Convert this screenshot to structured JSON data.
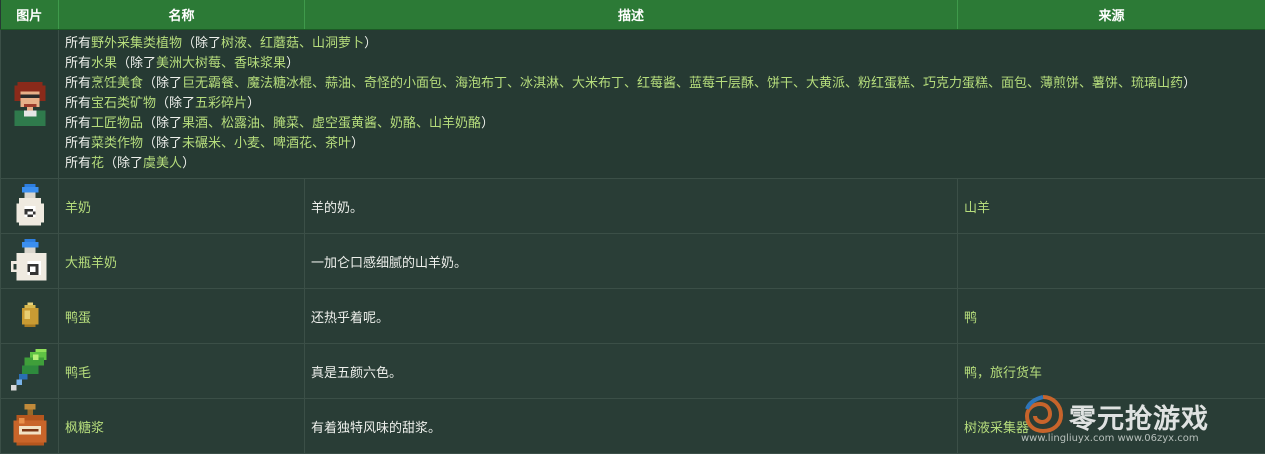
{
  "header": {
    "col_image": "图片",
    "col_name": "名称",
    "col_desc": "描述",
    "col_source": "来源"
  },
  "exclusions": {
    "prefix": "所有",
    "open": "（除了",
    "close": "）",
    "lines": [
      {
        "category": "野外采集类植物",
        "items": "树液、红蘑菇、山洞萝卜"
      },
      {
        "category": "水果",
        "items": "美洲大树莓、香味浆果"
      },
      {
        "category": "烹饪美食",
        "items": "巨无霸餐、魔法糖冰棍、蒜油、奇怪的小面包、海泡布丁、冰淇淋、大米布丁、红莓酱、蓝莓千层酥、饼干、大黄派、粉红蛋糕、巧克力蛋糕、面包、薄煎饼、薯饼、琉璃山药"
      },
      {
        "category": "宝石类矿物",
        "items": "五彩碎片"
      },
      {
        "category": "工匠物品",
        "items": "果酒、松露油、腌菜、虚空蛋黄酱、奶酪、山羊奶酪"
      },
      {
        "category": "菜类作物",
        "items": "未碾米、小麦、啤酒花、茶叶"
      },
      {
        "category": "花",
        "items": "虞美人"
      }
    ]
  },
  "rows": [
    {
      "name": "羊奶",
      "desc": "羊的奶。",
      "source": "山羊",
      "icon": "goat-milk-icon"
    },
    {
      "name": "大瓶羊奶",
      "desc": "一加仑口感细腻的山羊奶。",
      "source": "",
      "icon": "large-goat-milk-icon"
    },
    {
      "name": "鸭蛋",
      "desc": "还热乎着呢。",
      "source": "鸭",
      "icon": "duck-egg-icon"
    },
    {
      "name": "鸭毛",
      "desc": "真是五颜六色。",
      "source": "鸭，旅行货车",
      "icon": "duck-feather-icon"
    },
    {
      "name": "枫糖浆",
      "desc": "有着独特风味的甜浆。",
      "source": "树液采集器",
      "icon": "maple-syrup-icon"
    }
  ],
  "watermark": {
    "title": "零元抢游戏",
    "url": "www.lingliuyx.com    www.06zyx.com"
  },
  "colors": {
    "header_bg": "#2c7a36",
    "body_bg": "#263a33",
    "link": "#b6dd7c",
    "text": "#eef0ec"
  }
}
